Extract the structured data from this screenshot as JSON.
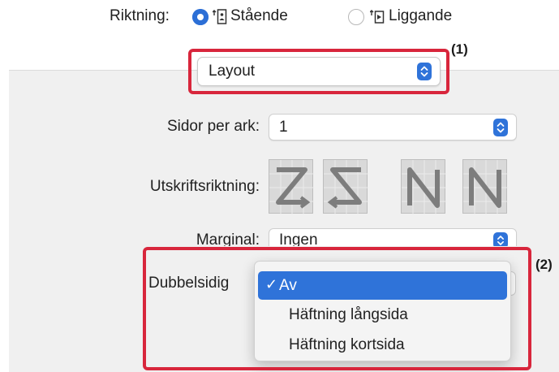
{
  "orientation": {
    "label": "Riktning:",
    "portrait_label": "Stående",
    "landscape_label": "Liggande",
    "selected": "Stående"
  },
  "layout_popup": {
    "value": "Layout"
  },
  "callouts": {
    "one": "(1)",
    "two": "(2)"
  },
  "pages_per_sheet": {
    "label": "Sidor per ark:",
    "value": "1"
  },
  "print_direction": {
    "label": "Utskriftsriktning:"
  },
  "margin": {
    "label": "Marginal:",
    "value": "Ingen"
  },
  "duplex": {
    "label": "Dubbelsidig",
    "options": [
      "Av",
      "Häftning långsida",
      "Häftning kortsida"
    ],
    "selected": "Av"
  },
  "colors": {
    "accent": "#2f73d9",
    "callout_box": "#d8263c",
    "panel": "#f0f0f0"
  }
}
